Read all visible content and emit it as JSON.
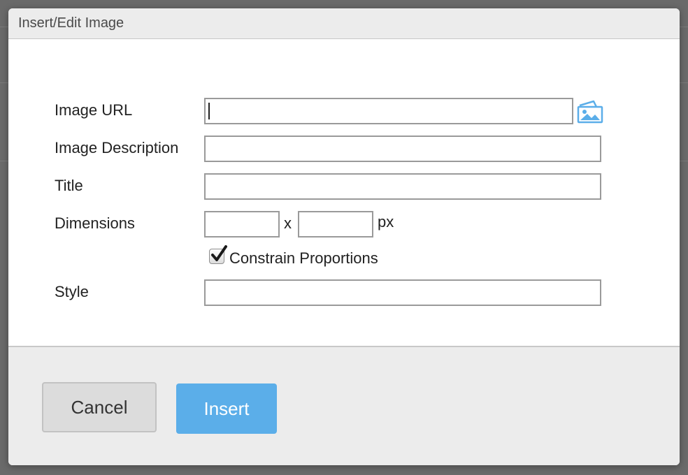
{
  "dialog": {
    "title": "Insert/Edit Image"
  },
  "form": {
    "image_url": {
      "label": "Image URL",
      "value": ""
    },
    "image_description": {
      "label": "Image Description",
      "value": ""
    },
    "title": {
      "label": "Title",
      "value": ""
    },
    "dimensions": {
      "label": "Dimensions",
      "width": "",
      "height": "",
      "separator": "x",
      "unit": "px"
    },
    "constrain": {
      "label": "Constrain Proportions",
      "checked": true
    },
    "style": {
      "label": "Style",
      "value": ""
    }
  },
  "footer": {
    "cancel_label": "Cancel",
    "insert_label": "Insert"
  },
  "icons": {
    "browse": "image-browse-icon",
    "check": "checkmark-icon"
  },
  "colors": {
    "accent": "#5baee9",
    "header_bg": "#ececec",
    "overlay": "#6a6a6a"
  }
}
